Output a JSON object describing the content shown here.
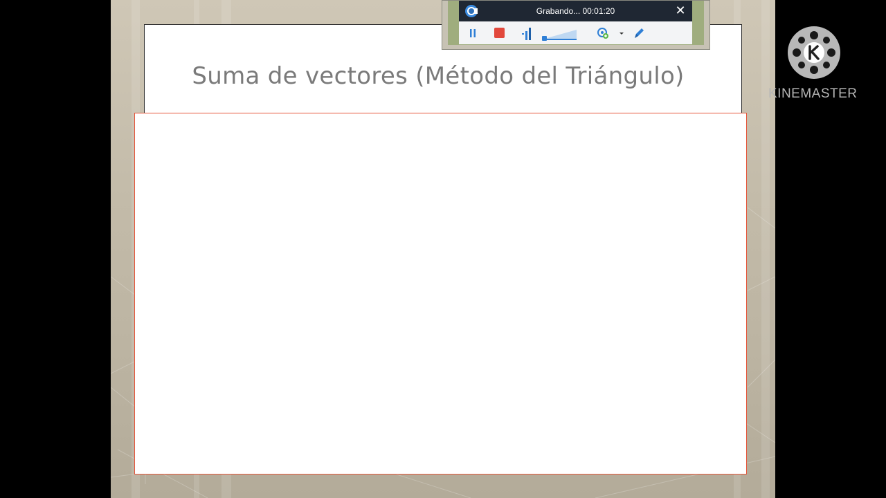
{
  "recorder": {
    "status_text": "Grabando... 00:01:20",
    "close_label": "✕",
    "logo_icon": "camera-record-icon",
    "toolbar": {
      "pause_icon": "pause-icon",
      "stop_icon": "stop-icon",
      "audio_icon": "audio-level-icon",
      "volume_icon": "volume-slider-icon",
      "webcam_icon": "webcam-icon",
      "dropdown_icon": "chevron-down-icon",
      "pen_icon": "pen-icon"
    }
  },
  "slide": {
    "title": "Suma de vectores (Método del Triángulo)"
  },
  "watermark": {
    "brand_text": "KINEMASTER",
    "logo_icon": "kinemaster-logo-icon"
  },
  "colors": {
    "content_border": "#e5553a",
    "title_text": "#7a7a7a",
    "recorder_bar": "#1f2733",
    "stop_red": "#e2483c",
    "accent_blue": "#2f7fd6"
  }
}
